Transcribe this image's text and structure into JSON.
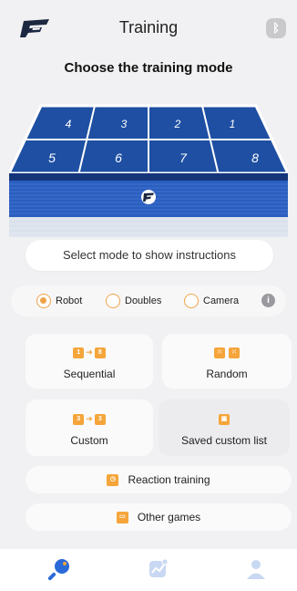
{
  "header": {
    "title": "Training",
    "bluetooth_icon": "bluetooth-icon"
  },
  "subtitle": "Choose the training mode",
  "table": {
    "zones_far": [
      "4",
      "3",
      "2",
      "1"
    ],
    "zones_near": [
      "5",
      "6",
      "7",
      "8"
    ],
    "colors": {
      "surface": "#1e4fa3",
      "lines": "#ffffff"
    }
  },
  "instructions": "Select mode to show instructions",
  "modes": {
    "options": [
      "Robot",
      "Doubles",
      "Camera"
    ],
    "selected": "Robot"
  },
  "cards": {
    "sequential": {
      "label": "Sequential",
      "icon_a": "1",
      "icon_b": "8"
    },
    "random": {
      "label": "Random"
    },
    "custom": {
      "label": "Custom",
      "icon_a": "3",
      "icon_b": "3"
    },
    "saved": {
      "label": "Saved custom list"
    }
  },
  "reaction": {
    "label": "Reaction training"
  },
  "other": {
    "label": "Other games"
  },
  "colors": {
    "accent": "#f5a53a",
    "radio": "#f0a24a",
    "tab_active": "#2a6ad8",
    "tab_inactive": "#c9d8f2"
  }
}
